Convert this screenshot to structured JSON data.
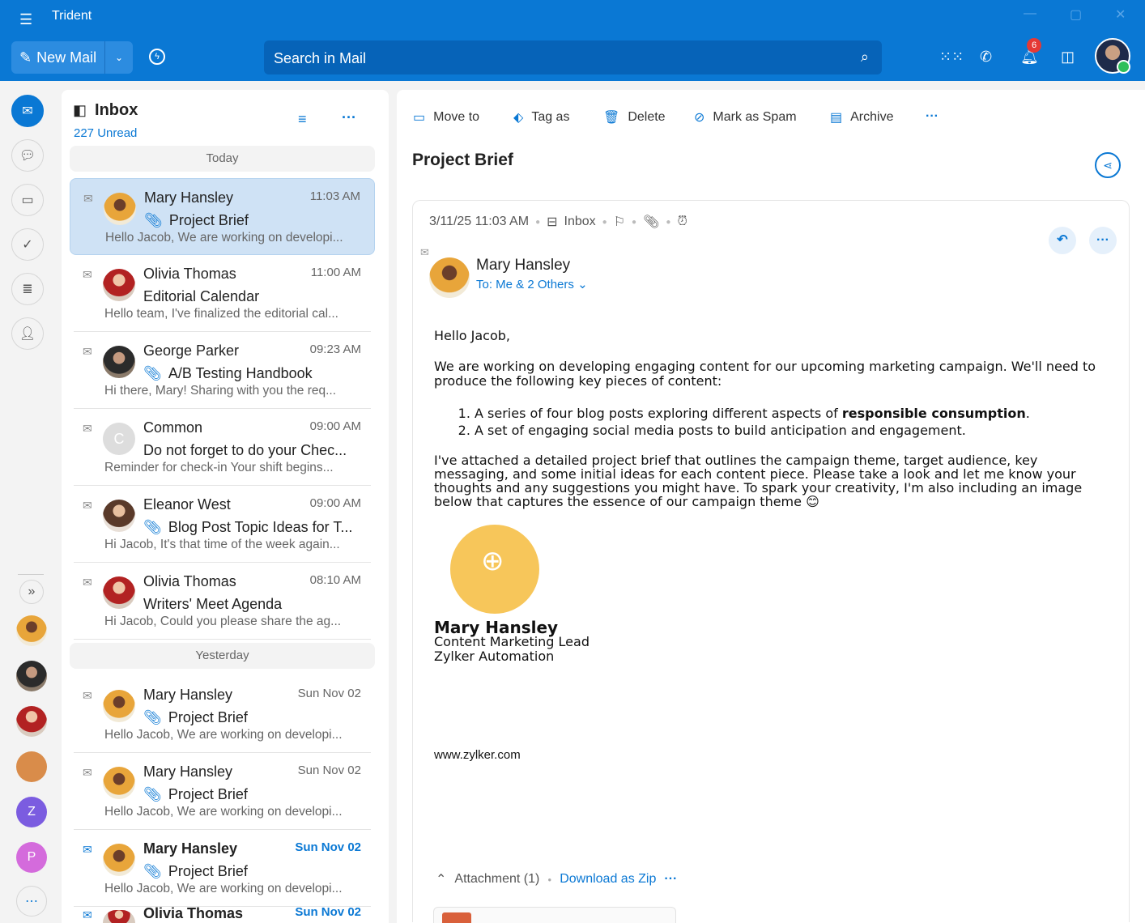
{
  "app": {
    "title": "Trident"
  },
  "toolbar": {
    "new_mail": "New Mail",
    "search_placeholder": "Search in Mail",
    "notif_count": "6"
  },
  "list": {
    "title": "Inbox",
    "unread": "227 Unread",
    "groups": {
      "today": "Today",
      "yesterday": "Yesterday"
    },
    "items": [
      {
        "from": "Mary Hansley",
        "time": "11:03 AM",
        "subject": "Project Brief",
        "preview": "Hello Jacob, We are working on developi...",
        "attach": true,
        "av": "",
        "sel": true
      },
      {
        "from": "Olivia Thomas",
        "time": "11:00 AM",
        "subject": "Editorial Calendar",
        "preview": "Hello team, I've finalized the editorial cal...",
        "attach": false,
        "av": "o"
      },
      {
        "from": "George Parker",
        "time": "09:23 AM",
        "subject": "A/B Testing Handbook",
        "preview": "Hi there, Mary! Sharing with you the req...",
        "attach": true,
        "av": "g"
      },
      {
        "from": "Common",
        "time": "09:00 AM",
        "subject": "Do not forget to do your Chec...",
        "preview": "Reminder for check-in Your shift begins...",
        "attach": false,
        "av": "c",
        "initial": "C"
      },
      {
        "from": "Eleanor West",
        "time": "09:00 AM",
        "subject": "Blog Post Topic Ideas for T...",
        "preview": "Hi Jacob, It's that time of the week again...",
        "attach": true,
        "av": "e"
      },
      {
        "from": "Olivia Thomas",
        "time": "08:10 AM",
        "subject": "Writers' Meet Agenda",
        "preview": "Hi Jacob, Could you please share the ag...",
        "attach": false,
        "av": "o"
      },
      {
        "from": "Mary Hansley",
        "time": "Sun Nov 02",
        "subject": "Project Brief",
        "preview": "Hello Jacob, We are working on developi...",
        "attach": true,
        "av": ""
      },
      {
        "from": "Mary Hansley",
        "time": "Sun Nov 02",
        "subject": "Project Brief",
        "preview": "Hello Jacob, We are working on developi...",
        "attach": true,
        "av": ""
      },
      {
        "from": "Mary Hansley",
        "time": "Sun Nov 02",
        "subject": "Project Brief",
        "preview": "Hello Jacob, We are working on developi...",
        "attach": true,
        "av": "",
        "unread": true
      },
      {
        "from": "Olivia Thomas",
        "time": "Sun Nov 02",
        "subject": "",
        "preview": "",
        "attach": false,
        "av": "o",
        "unread": true
      }
    ]
  },
  "rail": {
    "z": "Z",
    "p": "P"
  },
  "actions": {
    "move": "Move to",
    "tag": "Tag as",
    "delete": "Delete",
    "spam": "Mark as Spam",
    "archive": "Archive"
  },
  "mail": {
    "title": "Project Brief",
    "datetime": "3/11/25 11:03 AM",
    "folder": "Inbox",
    "sender": "Mary Hansley",
    "to": "To: Me & 2 Others",
    "greeting": "Hello Jacob,",
    "p1": "We are working on developing engaging content for our upcoming marketing campaign. We'll need to produce the following key pieces of content:",
    "li1_pre": "A series of four blog posts exploring different aspects of ",
    "li1_bold": "responsible consumption",
    "li1_post": ".",
    "li2": "A set of engaging social media posts to build anticipation and engagement.",
    "p2": "I've attached a detailed project brief that outlines the campaign theme, target audience, key messaging, and some initial ideas for each content piece. Please take a look and let me know your thoughts and any suggestions you might have. To spark your creativity, I'm also including an image below that captures the essence of our campaign theme 😊",
    "sig_name": "Mary Hansley",
    "sig_role": "Content Marketing Lead",
    "sig_company": "Zylker Automation",
    "website": "www.zylker.com",
    "attachment": "Attachment (1)",
    "download": "Download as Zip"
  }
}
